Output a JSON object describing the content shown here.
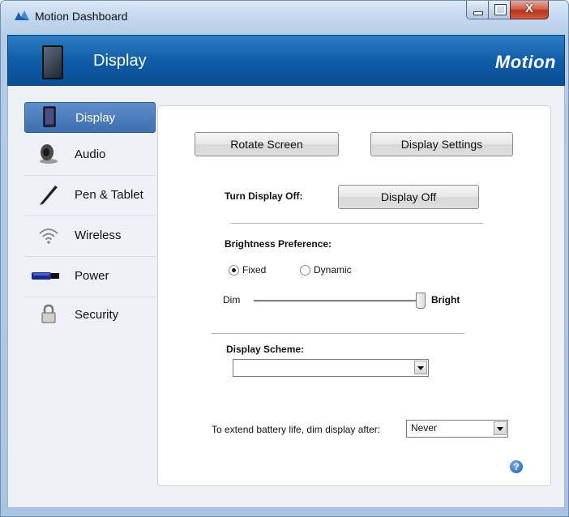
{
  "window": {
    "title": "Motion Dashboard",
    "close_glyph": "X"
  },
  "header": {
    "title": "Display",
    "brand": "Motion"
  },
  "sidebar": {
    "items": [
      {
        "label": "Display",
        "icon": "tablet-icon",
        "active": true
      },
      {
        "label": "Audio",
        "icon": "speaker-icon",
        "active": false
      },
      {
        "label": "Pen & Tablet",
        "icon": "pen-icon",
        "active": false
      },
      {
        "label": "Wireless",
        "icon": "wireless-icon",
        "active": false
      },
      {
        "label": "Power",
        "icon": "battery-icon",
        "active": false
      },
      {
        "label": "Security",
        "icon": "lock-icon",
        "active": false
      }
    ]
  },
  "content": {
    "rotate_screen": "Rotate Screen",
    "display_settings": "Display Settings",
    "turn_off_label": "Turn Display Off:",
    "display_off": "Display Off",
    "brightness_label": "Brightness Preference:",
    "fixed": "Fixed",
    "dynamic": "Dynamic",
    "selected_mode": "Fixed",
    "dim": "Dim",
    "bright": "Bright",
    "brightness_level": 1.0,
    "scheme_label": "Display Scheme:",
    "scheme_value": "",
    "battery_label": "To extend battery life, dim display after:",
    "battery_value": "Never",
    "help": "?"
  },
  "colors": {
    "header_blue": "#0e5ba6",
    "active_nav": "#3e6fb0",
    "close_red": "#c8452c"
  }
}
